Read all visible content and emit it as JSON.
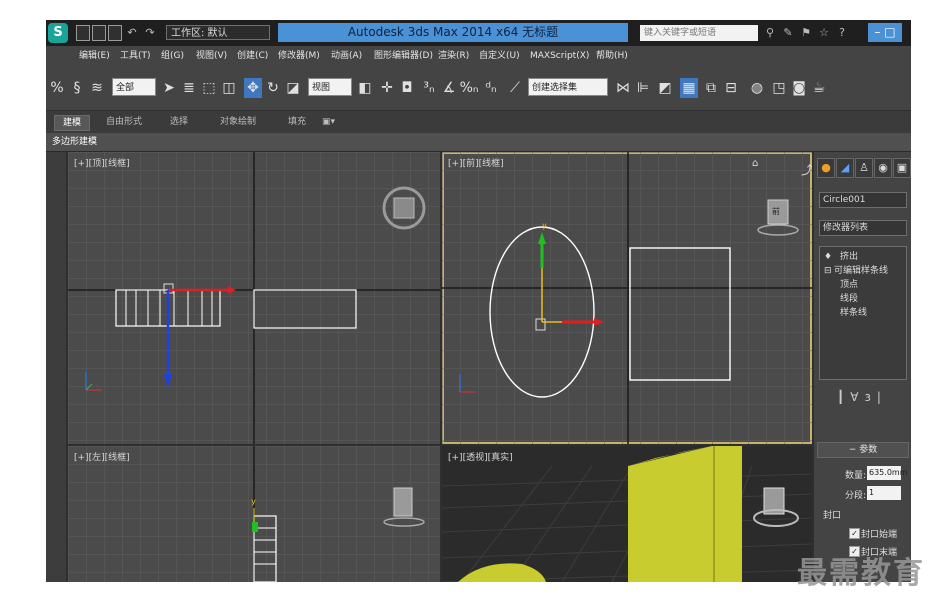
{
  "titlebar": {
    "app_title": "Autodesk 3ds Max  2014 x64      无标题",
    "workspace_label": "工作区: 默认",
    "search_placeholder": "键入关键字或短语",
    "help_icon": "?",
    "minimize_label": "–  □"
  },
  "menus": [
    "编辑(E)",
    "工具(T)",
    "组(G)",
    "视图(V)",
    "创建(C)",
    "修改器(M)",
    "动画(A)",
    "图形编辑器(D)",
    "渲染(R)",
    "自定义(U)",
    "MAXScript(X)",
    "帮助(H)"
  ],
  "toolbar": {
    "selection_filter": "全部",
    "reference_coord": "视图",
    "named_selection": "创建选择集"
  },
  "ribbon": {
    "tabs": [
      "建模",
      "自由形式",
      "选择",
      "对象绘制",
      "填充"
    ],
    "active_tab": "建模",
    "subtab": "多边形建模"
  },
  "viewports": {
    "top_left": "[+][顶][线框]",
    "top_right": "[+][前][线框]",
    "bottom_left": "[+][左][线框]",
    "bottom_right": "[+][透视][真实]",
    "viewcube_front": "前"
  },
  "command_panel": {
    "object_name": "Circle001",
    "modifier_list": "修改器列表",
    "stack": {
      "extrude": "挤出",
      "editable_spline": "可编辑样条线",
      "vertex": "顶点",
      "segment": "线段",
      "spline": "样条线"
    },
    "rollout_title": "参数",
    "amount_label": "数量:",
    "amount_value": "635.0mm",
    "segments_label": "分段:",
    "segments_value": "1",
    "capping_label": "封口",
    "cap_start_label": "封口始端",
    "cap_end_label": "封口末端"
  },
  "watermark": "最需教育",
  "colors": {
    "titlebar_bg": "#1f1f1f",
    "title_highlight": "#4a91d6",
    "viewport_bg": "#4b4b4b",
    "perspective_bg": "#2b2b2b",
    "active_border": "#c9b36a",
    "box_yellow": "#c8cc2e"
  }
}
